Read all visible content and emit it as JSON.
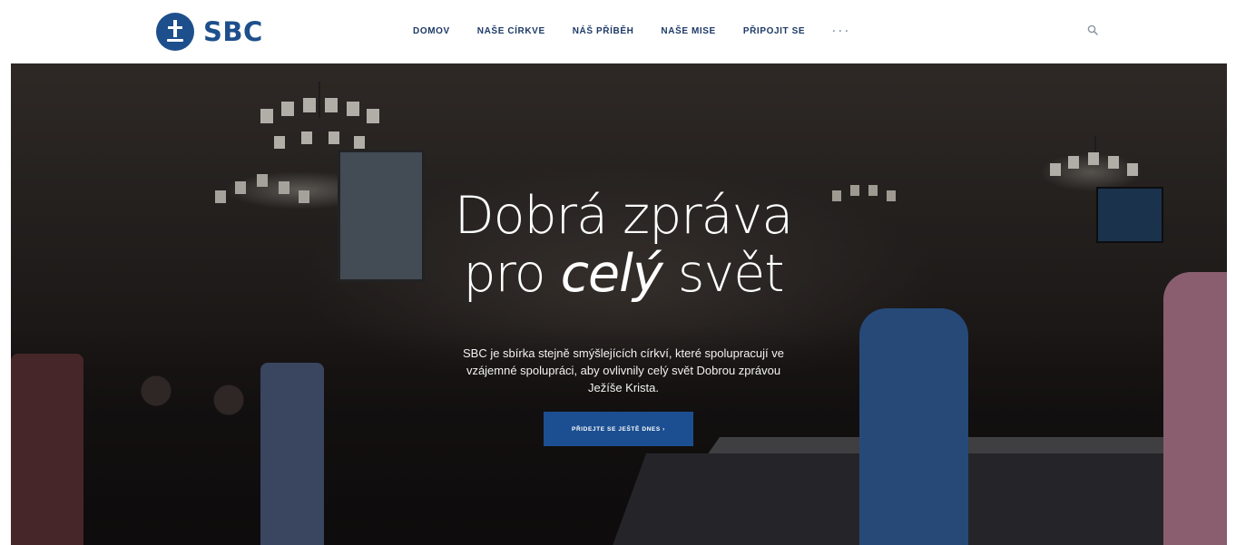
{
  "brand": {
    "name": "SBC"
  },
  "nav": {
    "items": [
      "DOMOV",
      "NAŠE CÍRKVE",
      "NÁŠ PŘÍBĚH",
      "NAŠE MISE",
      "PŘIPOJIT SE"
    ],
    "more": "···"
  },
  "search": {
    "icon": "search-icon"
  },
  "hero": {
    "headline_line1": "Dobrá zpráva",
    "headline_pro": "pro ",
    "headline_em": "celý",
    "headline_end": " svět",
    "subtext": "SBC je sbírka stejně smýšlejících církví, které spolupracují ve vzájemné spolupráci, aby ovlivnily celý svět Dobrou zprávou Ježíše Krista.",
    "cta_label": "PŘIDEJTE SE JEŠTĚ DNES ›"
  },
  "colors": {
    "brand": "#1d4f8c",
    "nav_text": "#1e3a66",
    "cta_bg": "#1c4f91"
  }
}
